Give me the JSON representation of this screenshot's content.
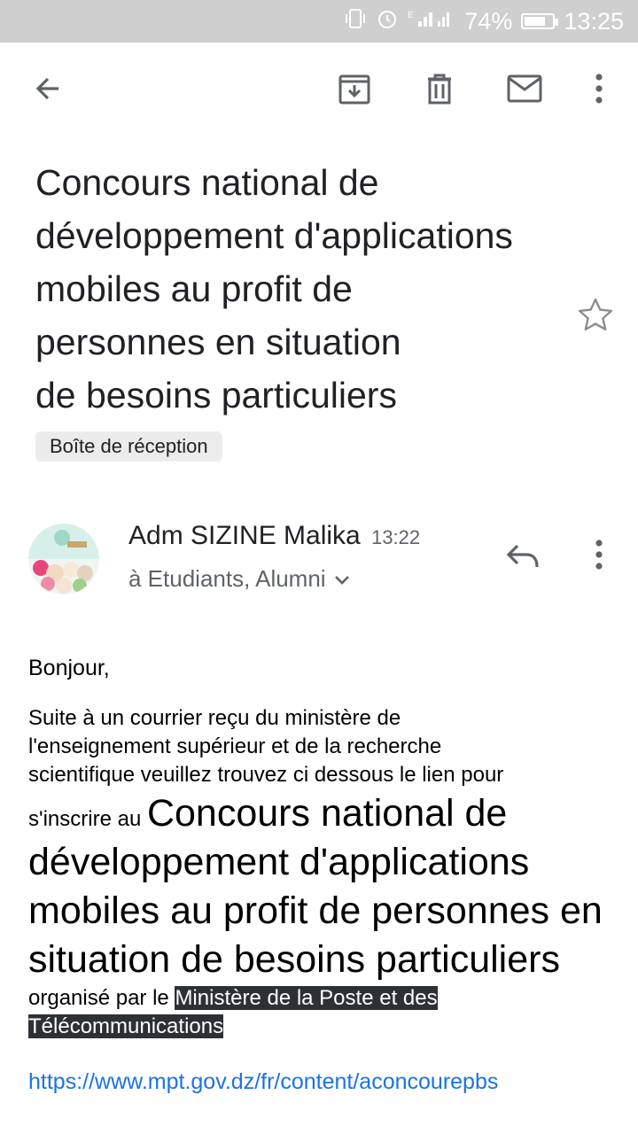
{
  "status_bar": {
    "battery": "74%",
    "time": "13:25",
    "battery_level": 0.74
  },
  "toolbar": {
    "back": "back-icon",
    "archive": "archive-icon",
    "delete": "delete-icon",
    "mark_unread": "mail-icon",
    "more": "more-vert-icon"
  },
  "subject_lines": [
    "Concours national de",
    "développement d'applications",
    "mobiles au profit de",
    "personnes en situation",
    "de besoins particuliers"
  ],
  "label": "Boîte de réception",
  "message": {
    "sender": "Adm SIZINE Malika",
    "time": "13:22",
    "recipients": "à Etudiants, Alumni"
  },
  "body": {
    "greeting": "Bonjour,",
    "intro_lines": [
      "Suite à un courrier reçu du ministère  de",
      "l'enseignement supérieur et de la recherche",
      "scientifique veuillez trouvez ci dessous le lien pour"
    ],
    "inscribe": "s'inscrire au ",
    "big_title": "Concours national de développement d'applications mobiles au profit de personnes en situation de besoins particuliers",
    "organised": " organisé par  le ",
    "ministry": "Ministère de la Poste et des Télécommunications",
    "link": "https://www.mpt.gov.dz/fr/content/aconcourepbs"
  },
  "colors": {
    "status_bar": "#cfcfcf",
    "link": "#1a73e8",
    "highlight": "#2d3136"
  }
}
